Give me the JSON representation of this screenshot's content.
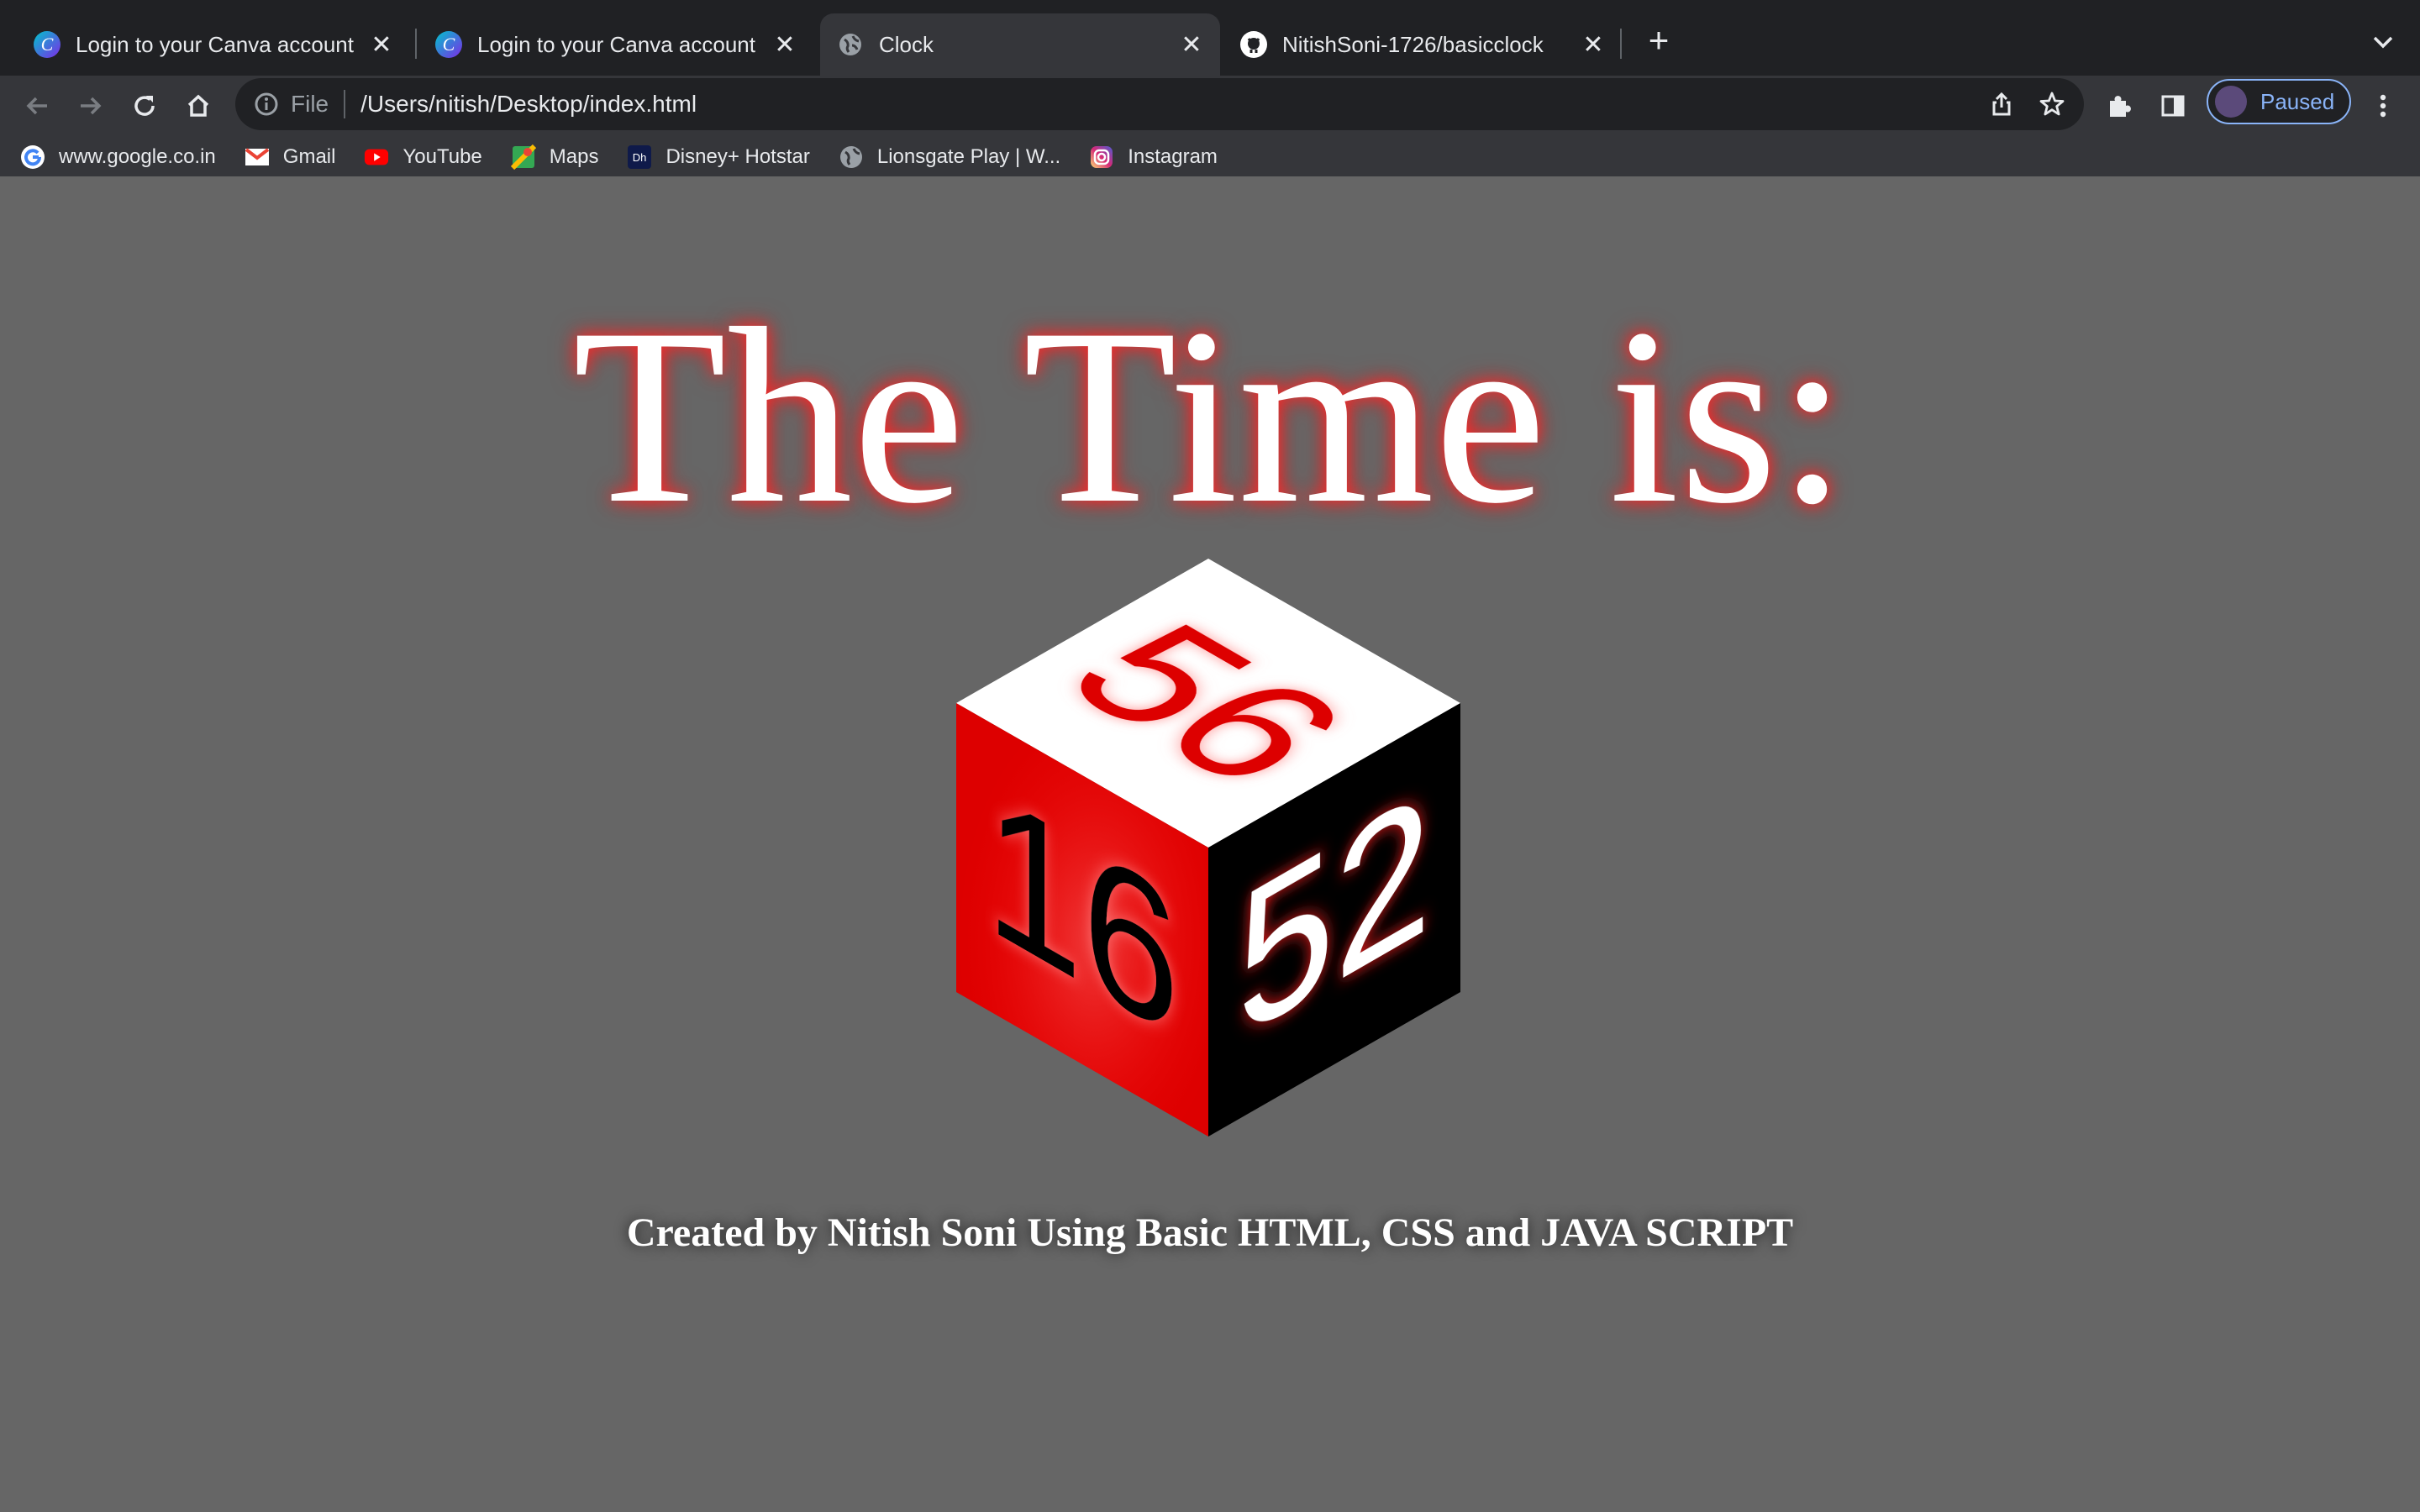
{
  "tabs": [
    {
      "title": "Login to your Canva account",
      "icon": "canva-icon"
    },
    {
      "title": "Login to your Canva account",
      "icon": "canva-icon"
    },
    {
      "title": "Clock",
      "icon": "globe-icon",
      "active": true
    },
    {
      "title": "NitishSoni-1726/basicclock",
      "icon": "github-icon"
    }
  ],
  "toolbar": {
    "scheme_label": "File",
    "url": "/Users/nitish/Desktop/index.html",
    "profile_label": "Paused"
  },
  "bookmarks": [
    {
      "label": "www.google.co.in",
      "icon": "google-icon"
    },
    {
      "label": "Gmail",
      "icon": "gmail-icon"
    },
    {
      "label": "YouTube",
      "icon": "youtube-icon"
    },
    {
      "label": "Maps",
      "icon": "maps-icon"
    },
    {
      "label": "Disney+ Hotstar",
      "icon": "hotstar-icon"
    },
    {
      "label": "Lionsgate Play | W...",
      "icon": "globe-icon"
    },
    {
      "label": "Instagram",
      "icon": "instagram-icon"
    }
  ],
  "page": {
    "heading": "The Time is:",
    "hours": "16",
    "minutes": "52",
    "seconds": "56",
    "footer": "Created by Nitish Soni Using Basic HTML, CSS and JAVA SCRIPT"
  },
  "colors": {
    "page_background": "#666666",
    "accent_red": "#dd0000",
    "cube_top": "#ffffff",
    "cube_right": "#000000"
  }
}
